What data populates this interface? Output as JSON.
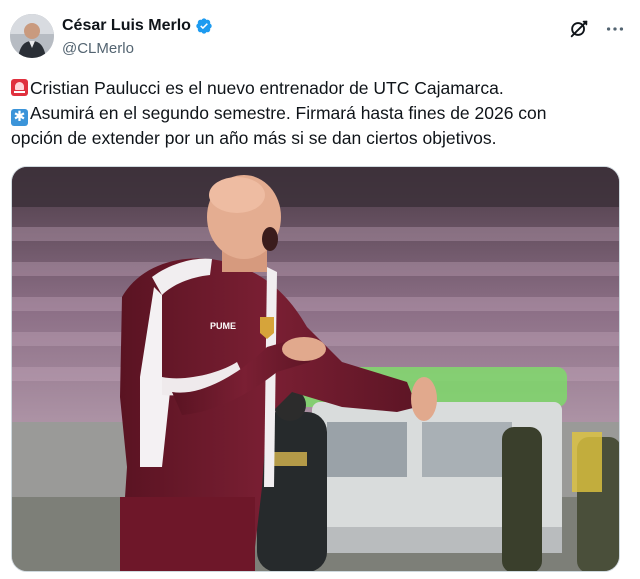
{
  "author": {
    "display_name": "César Luis Merlo",
    "handle": "@CLMerlo",
    "verified": true,
    "avatar_icon": "avatar-photo"
  },
  "actions": {
    "grok_icon": "grok-icon",
    "more_icon": "more-dots-icon"
  },
  "tweet": {
    "line1_emoji": "siren-emoji",
    "line1": "Cristian Paulucci es el nuevo entrenador de UTC Cajamarca.",
    "line2_emoji": "snowflake-emoji",
    "line2": "Asumirá en el segundo semestre. Firmará hasta fines de 2026 con",
    "line3": "opción de extender por un año más si se dan ciertos objetivos."
  },
  "media": {
    "jacket_brand": "PUME"
  },
  "colors": {
    "verified_badge": "#1d9bf0",
    "text": "#0f1419",
    "secondary_text": "#536471",
    "jacket": "#6b1a2b"
  }
}
